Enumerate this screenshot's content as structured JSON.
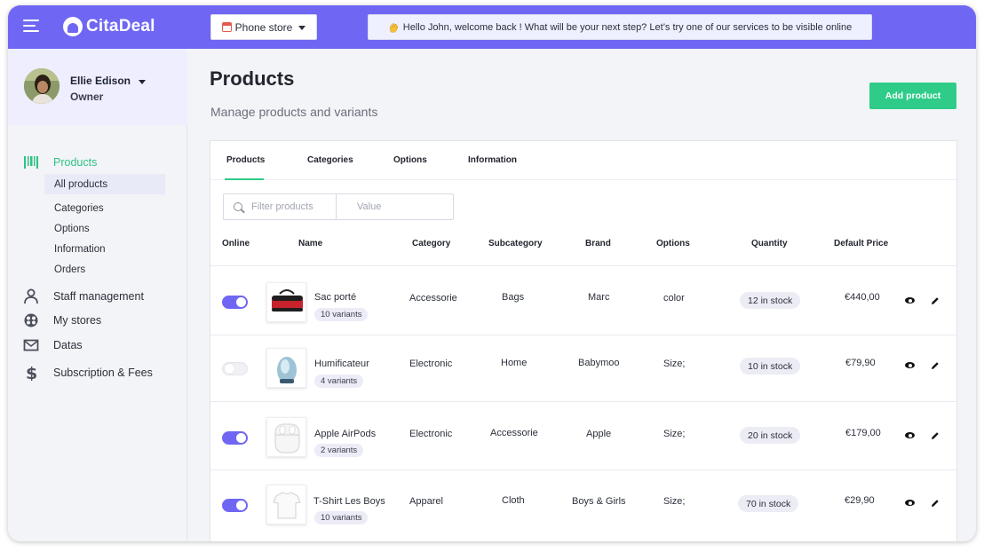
{
  "header": {
    "logo": "CitaDeal",
    "store_select": "Phone store",
    "welcome": "Hello John, welcome back !  What will be your next step? Let’s try one of our services to be visible online"
  },
  "profile": {
    "name": "Ellie Edison",
    "role": "Owner"
  },
  "sidebar": {
    "products": "Products",
    "sub": [
      "All products",
      "Categories",
      "Options",
      "Information",
      "Orders"
    ],
    "staff": "Staff management",
    "stores": "My stores",
    "datas": "Datas",
    "subscription": "Subscription & Fees"
  },
  "page": {
    "title": "Products",
    "subtitle": "Manage products and variants",
    "add_button": "Add product"
  },
  "tabs": [
    "Products",
    "Categories",
    "Options",
    "Information"
  ],
  "filter": {
    "search_placeholder": "Filter products",
    "value_placeholder": "Value"
  },
  "columns": [
    "Online",
    "Name",
    "Category",
    "Subcategory",
    "Brand",
    "Options",
    "Quantity",
    "Default Price"
  ],
  "rows": [
    {
      "online": true,
      "name": "Sac porté",
      "variants": "10 variants",
      "category": "Accessorie",
      "subcategory": "Bags",
      "brand": "Marc",
      "options": "color",
      "stock": "12 in stock",
      "price": "€440,00"
    },
    {
      "online": false,
      "name": "Humificateur",
      "variants": "4 variants",
      "category": "Electronic",
      "subcategory": "Home",
      "brand": "Babymoo",
      "options": "Size;",
      "stock": "10 in stock",
      "price": "€79,90"
    },
    {
      "online": true,
      "name": "Apple AirPods",
      "variants": "2 variants",
      "category": "Electronic",
      "subcategory": "Accessorie",
      "brand": "Apple",
      "options": "Size;",
      "stock": "20 in stock",
      "price": "€179,00"
    },
    {
      "online": true,
      "name": "T-Shirt Les Boys",
      "variants": "10 variants",
      "category": "Apparel",
      "subcategory": "Cloth",
      "brand": "Boys & Girls",
      "options": "Size;",
      "stock": "70 in stock",
      "price": "€29,90"
    }
  ],
  "colors": {
    "brand": "#6f67f3",
    "accent": "#2ecc88",
    "toggle_on": "#6f67f3"
  },
  "icons": [
    "menu-icon",
    "store-icon",
    "wave-icon",
    "barcode-icon",
    "person-icon",
    "store-ball-icon",
    "mail-icon",
    "dollar-icon",
    "search-icon",
    "eye-icon",
    "edit-icon"
  ]
}
